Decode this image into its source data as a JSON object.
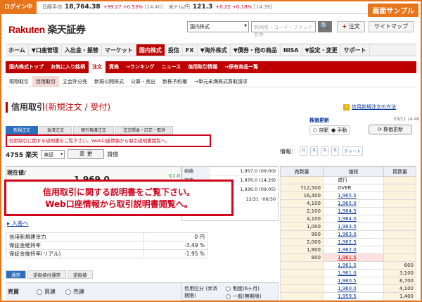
{
  "topbar": {
    "login": "ログイン中",
    "nikkei_label": "日経平均",
    "nikkei_value": "18,764.38",
    "nikkei_change": "+99.27 +0.53%",
    "nikkei_time": "[14:40]",
    "usd_label": "米ドル/円",
    "usd_value": "121.3",
    "usd_change": "+0.22 +0.18%",
    "usd_time": "[14:39]",
    "sample_badge": "画面サンプル"
  },
  "header": {
    "logo": "Rakuten",
    "logo_sub": "楽天証券",
    "search_select": "国内株式",
    "search_placeholder": "銘柄名・コード・ファンド名等",
    "search_icon": "🔍",
    "order_button": "注文",
    "sitemap_button": "サイトマップ"
  },
  "nav_main": [
    "ホーム",
    "▼口座管理",
    "入出金・振替",
    "マーケット",
    "国内株式",
    "投信",
    "FX",
    "▼海外株式",
    "▼債券・他の商品",
    "NISA",
    "▼設定・変更",
    "サポート"
  ],
  "nav_sub": [
    "国内株式トップ",
    "お気に入り銘柄",
    "注文",
    "資株",
    "→ランキング",
    "ニュース",
    "信用取引情報",
    "→保有商品一覧"
  ],
  "nav_third": [
    "現物取引",
    "信用取引",
    "立会外分売",
    "新規公開株式",
    "公募・売出",
    "新株予約権",
    "→単元未満株式買取請求"
  ],
  "page": {
    "title": "信用取引",
    "title_sub": "(新規注文 / 受付)",
    "help_link": "信用新規注文の方法",
    "help_icon": "?",
    "update_label": "株価更新",
    "update_time": "03/11 14:40",
    "auto_label": "自動",
    "manual_label": "手動",
    "update_button": "株価更新"
  },
  "order_tabs": [
    "新規注文",
    "返済注文",
    "現引現渡注文",
    "注文照会・訂正・取消"
  ],
  "notice": "信用取引に関する説明書をご覧下さい。Web口座情報から取引説明書閲覧へ。",
  "stock": {
    "code_name": "4755 楽天",
    "market": "東証",
    "change_button": "変 更",
    "kind": "貸借",
    "price_label": "現在値/",
    "price": "1,969.0",
    "price_change": "-11.0"
  },
  "info": {
    "label": "情報：",
    "icons": [
      "⇅",
      "⇅",
      "⇅",
      "⇅",
      "チャート"
    ]
  },
  "ohlc": [
    {
      "k": "始値",
      "v": "1,957.0 (09:00)"
    },
    {
      "k": "高値",
      "v": "1,976.0 (14:29)"
    },
    {
      "k": "安値",
      "v": "1,936.0 (09:05)"
    },
    {
      "k": "前日",
      "v": "12/31 ･06/30"
    }
  ],
  "overlay_message": [
    "信用取引に関する説明書をご覧下さい。",
    "Web口座情報から取引説明書閲覧へ。"
  ],
  "deposit_link": "入金へ",
  "margin": [
    {
      "k": "信用新規建余力",
      "v": "0 円"
    },
    {
      "k": "保証金維持率",
      "v": "-3.49 %"
    },
    {
      "k": "保証金維持率(リアル)",
      "v": "-1.95 %"
    }
  ],
  "lower_tabs": [
    "通常",
    "逆指値付通常",
    "逆指値"
  ],
  "trade": {
    "label": "売買",
    "buy": "買建",
    "sell": "売建",
    "credit_label": "信用区分 (弁済期限)",
    "credit_opt1": "制度(6ヶ月)",
    "credit_opt2": "一般(無期限)"
  },
  "board": {
    "headers": [
      "売数量",
      "値段",
      "買数量"
    ],
    "rows": [
      {
        "ask": "",
        "price": "成行",
        "bid": ""
      },
      {
        "ask": "712,500",
        "price": "OVER",
        "bid": ""
      },
      {
        "ask": "16,400",
        "price": "1,965.5",
        "bid": ""
      },
      {
        "ask": "4,100",
        "price": "1,965.0",
        "bid": ""
      },
      {
        "ask": "2,100",
        "price": "1,964.5",
        "bid": ""
      },
      {
        "ask": "4,100",
        "price": "1,964.0",
        "bid": ""
      },
      {
        "ask": "1,000",
        "price": "1,963.5",
        "bid": ""
      },
      {
        "ask": "900",
        "price": "1,963.0",
        "bid": ""
      },
      {
        "ask": "2,000",
        "price": "1,962.5",
        "bid": ""
      },
      {
        "ask": "1,900",
        "price": "1,962.0",
        "bid": ""
      },
      {
        "ask": "800",
        "price": "1,961.5",
        "bid": ""
      },
      {
        "ask": "",
        "price": "1,961.5",
        "bid": "600"
      },
      {
        "ask": "",
        "price": "1,961.0",
        "bid": "3,100"
      },
      {
        "ask": "",
        "price": "1,960.5",
        "bid": "6,700"
      },
      {
        "ask": "",
        "price": "1,960.0",
        "bid": "4,100"
      },
      {
        "ask": "",
        "price": "1,959.5",
        "bid": "1,400"
      }
    ]
  },
  "colors": {
    "brand": "#bf0000",
    "accent": "#e8751a",
    "link": "#003399"
  }
}
